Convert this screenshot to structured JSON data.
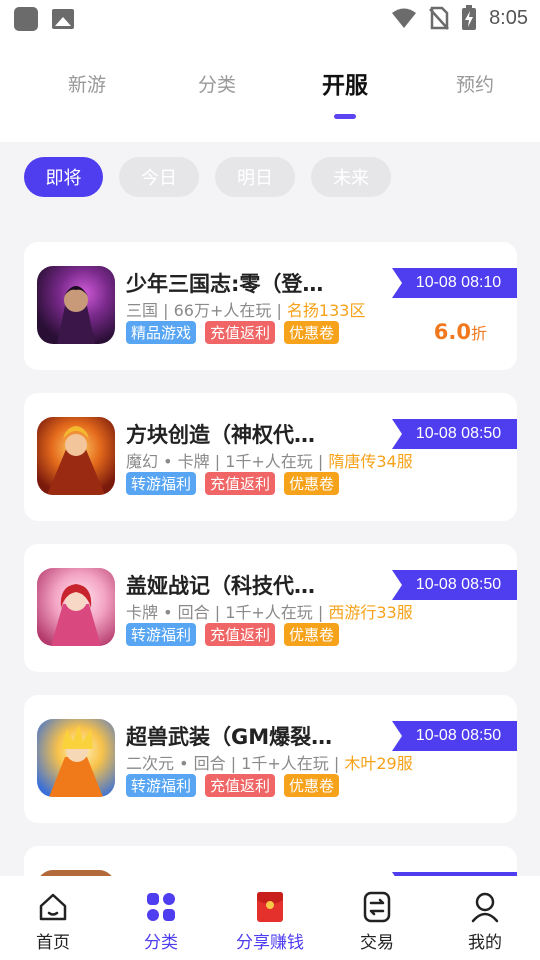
{
  "status_bar": {
    "time": "8:05"
  },
  "top_tabs": [
    {
      "label": "新游"
    },
    {
      "label": "分类"
    },
    {
      "label": "开服"
    },
    {
      "label": "预约"
    }
  ],
  "chips": [
    {
      "label": "即将"
    },
    {
      "label": "今日"
    },
    {
      "label": "明日"
    },
    {
      "label": "未来"
    }
  ],
  "games": [
    {
      "title": "少年三国志:零（登…",
      "genre": "三国",
      "players": "66万+人在玩",
      "server": "名扬133区",
      "tags": [
        "精品游戏",
        "充值返利",
        "优惠卷"
      ],
      "open_time": "10-08 08:10",
      "discount": "6.0",
      "discount_unit": "折"
    },
    {
      "title": "方块创造（神权代…",
      "genre": "魔幻 • 卡牌",
      "players": "1千+人在玩",
      "server": "隋唐传34服",
      "tags": [
        "转游福利",
        "充值返利",
        "优惠卷"
      ],
      "open_time": "10-08 08:50"
    },
    {
      "title": "盖娅战记（科技代…",
      "genre": "卡牌 • 回合",
      "players": "1千+人在玩",
      "server": "西游行33服",
      "tags": [
        "转游福利",
        "充值返利",
        "优惠卷"
      ],
      "open_time": "10-08 08:50"
    },
    {
      "title": "超兽武装（GM爆裂…",
      "genre": "二次元 • 回合",
      "players": "1千+人在玩",
      "server": "木叶29服",
      "tags": [
        "转游福利",
        "充值返利",
        "优惠卷"
      ],
      "open_time": "10-08 08:50"
    }
  ],
  "bottom_nav": [
    {
      "label": "首页",
      "icon": "home-icon"
    },
    {
      "label": "分类",
      "icon": "grid-icon"
    },
    {
      "label": "分享赚钱",
      "icon": "red-envelope-icon"
    },
    {
      "label": "交易",
      "icon": "trade-icon"
    },
    {
      "label": "我的",
      "icon": "user-icon"
    }
  ],
  "colors": {
    "accent": "#4f3df0",
    "discount": "#f0781e",
    "server": "#f6a21a"
  }
}
